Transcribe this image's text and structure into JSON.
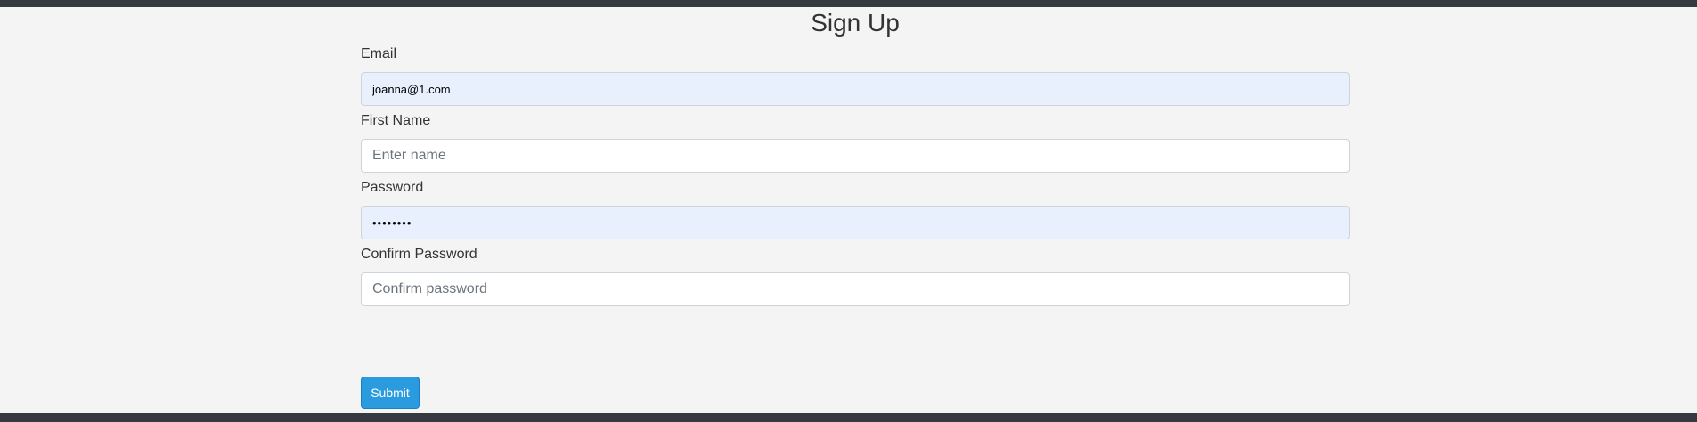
{
  "page": {
    "title": "Sign Up"
  },
  "form": {
    "email": {
      "label": "Email",
      "value": "joanna@1.com",
      "placeholder": ""
    },
    "first_name": {
      "label": "First Name",
      "value": "",
      "placeholder": "Enter name"
    },
    "password": {
      "label": "Password",
      "value": "12345678",
      "placeholder": ""
    },
    "confirm_password": {
      "label": "Confirm Password",
      "value": "",
      "placeholder": "Confirm password"
    },
    "submit_label": "Submit"
  },
  "colors": {
    "bar": "#343a40",
    "background": "#f4f4f4",
    "autofill": "#e8f0fe",
    "primary": "#2b9be0"
  }
}
